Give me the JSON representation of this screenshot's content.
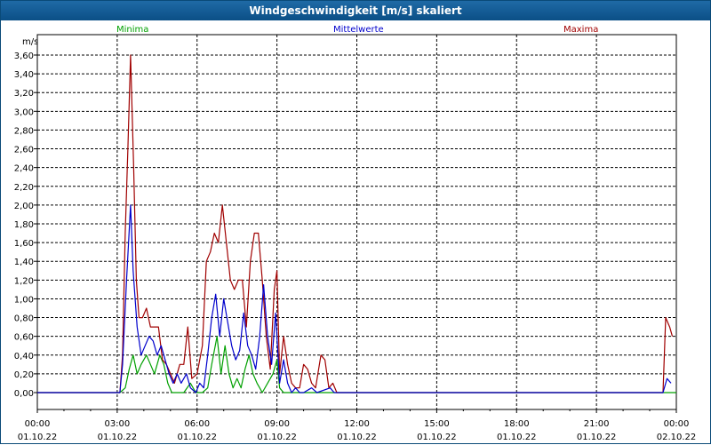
{
  "window": {
    "title": "Windgeschwindigkeit [m/s] skaliert"
  },
  "colors": {
    "min": "#00a000",
    "avg": "#0000cc",
    "max": "#a00000",
    "grid": "#000000",
    "titlebar": "#0b4f86"
  },
  "chart_data": {
    "type": "line",
    "title": "Windgeschwindigkeit [m/s] skaliert",
    "ylabel": "m/s",
    "xlabel": "",
    "ylim": [
      0,
      3.7
    ],
    "y_ticks": [
      "0,00",
      "0,20",
      "0,40",
      "0,60",
      "0,80",
      "1,00",
      "1,20",
      "1,40",
      "1,60",
      "1,80",
      "2,00",
      "2,20",
      "2,40",
      "2,60",
      "2,80",
      "3,00",
      "3,20",
      "3,40",
      "3,60"
    ],
    "x_ticks": [
      {
        "time": "00:00",
        "date": "01.10.22"
      },
      {
        "time": "03:00",
        "date": "01.10.22"
      },
      {
        "time": "06:00",
        "date": "01.10.22"
      },
      {
        "time": "09:00",
        "date": "01.10.22"
      },
      {
        "time": "12:00",
        "date": "01.10.22"
      },
      {
        "time": "15:00",
        "date": "01.10.22"
      },
      {
        "time": "18:00",
        "date": "01.10.22"
      },
      {
        "time": "21:00",
        "date": "01.10.22"
      },
      {
        "time": "00:00",
        "date": "02.10.22"
      }
    ],
    "xlim_hours": [
      0,
      24
    ],
    "grid": true,
    "legend_position": "top",
    "series": [
      {
        "name": "Minima",
        "color": "#00a000",
        "points": [
          [
            0,
            0
          ],
          [
            3.1,
            0
          ],
          [
            3.3,
            0.05
          ],
          [
            3.45,
            0.25
          ],
          [
            3.6,
            0.4
          ],
          [
            3.75,
            0.2
          ],
          [
            3.9,
            0.3
          ],
          [
            4.1,
            0.4
          ],
          [
            4.25,
            0.3
          ],
          [
            4.4,
            0.2
          ],
          [
            4.6,
            0.4
          ],
          [
            4.75,
            0.3
          ],
          [
            4.9,
            0.1
          ],
          [
            5.05,
            0
          ],
          [
            5.5,
            0
          ],
          [
            5.75,
            0.1
          ],
          [
            5.95,
            0
          ],
          [
            6.2,
            0
          ],
          [
            6.4,
            0.05
          ],
          [
            6.55,
            0.3
          ],
          [
            6.75,
            0.6
          ],
          [
            6.9,
            0.2
          ],
          [
            7.05,
            0.5
          ],
          [
            7.2,
            0.2
          ],
          [
            7.35,
            0.05
          ],
          [
            7.5,
            0.15
          ],
          [
            7.65,
            0.05
          ],
          [
            7.8,
            0.25
          ],
          [
            7.95,
            0.4
          ],
          [
            8.1,
            0.2
          ],
          [
            8.25,
            0.1
          ],
          [
            8.35,
            0.05
          ],
          [
            8.45,
            0
          ],
          [
            8.65,
            0.1
          ],
          [
            8.85,
            0.2
          ],
          [
            9.0,
            0.35
          ],
          [
            9.1,
            0.05
          ],
          [
            9.25,
            0
          ],
          [
            24,
            0
          ]
        ]
      },
      {
        "name": "Mittelwerte",
        "color": "#0000cc",
        "points": [
          [
            0,
            0
          ],
          [
            3.1,
            0
          ],
          [
            3.2,
            0.3
          ],
          [
            3.35,
            1.2
          ],
          [
            3.5,
            2.0
          ],
          [
            3.6,
            1.3
          ],
          [
            3.75,
            0.7
          ],
          [
            3.9,
            0.4
          ],
          [
            4.05,
            0.5
          ],
          [
            4.2,
            0.6
          ],
          [
            4.35,
            0.55
          ],
          [
            4.5,
            0.4
          ],
          [
            4.65,
            0.5
          ],
          [
            4.8,
            0.35
          ],
          [
            4.95,
            0.2
          ],
          [
            5.1,
            0.1
          ],
          [
            5.25,
            0.2
          ],
          [
            5.4,
            0.1
          ],
          [
            5.6,
            0.2
          ],
          [
            5.75,
            0.05
          ],
          [
            5.95,
            0
          ],
          [
            6.1,
            0.1
          ],
          [
            6.25,
            0.05
          ],
          [
            6.4,
            0.4
          ],
          [
            6.55,
            0.8
          ],
          [
            6.7,
            1.05
          ],
          [
            6.85,
            0.6
          ],
          [
            7.0,
            1.0
          ],
          [
            7.15,
            0.75
          ],
          [
            7.3,
            0.5
          ],
          [
            7.45,
            0.35
          ],
          [
            7.6,
            0.45
          ],
          [
            7.75,
            0.85
          ],
          [
            7.9,
            0.5
          ],
          [
            8.05,
            0.4
          ],
          [
            8.2,
            0.25
          ],
          [
            8.35,
            0.6
          ],
          [
            8.5,
            1.15
          ],
          [
            8.65,
            0.6
          ],
          [
            8.8,
            0.3
          ],
          [
            8.95,
            0.85
          ],
          [
            9.1,
            0.1
          ],
          [
            9.25,
            0.35
          ],
          [
            9.4,
            0.1
          ],
          [
            9.55,
            0
          ],
          [
            9.7,
            0.05
          ],
          [
            9.85,
            0
          ],
          [
            10.0,
            0
          ],
          [
            10.3,
            0.05
          ],
          [
            10.5,
            0
          ],
          [
            11.0,
            0.05
          ],
          [
            11.15,
            0
          ],
          [
            23.5,
            0
          ],
          [
            23.65,
            0.15
          ],
          [
            23.8,
            0.1
          ]
        ]
      },
      {
        "name": "Maxima",
        "color": "#a00000",
        "points": [
          [
            0,
            0
          ],
          [
            3.1,
            0
          ],
          [
            3.2,
            0.4
          ],
          [
            3.3,
            1.7
          ],
          [
            3.4,
            2.6
          ],
          [
            3.5,
            3.6
          ],
          [
            3.62,
            2.4
          ],
          [
            3.72,
            1.2
          ],
          [
            3.82,
            0.8
          ],
          [
            3.95,
            0.8
          ],
          [
            4.1,
            0.9
          ],
          [
            4.25,
            0.7
          ],
          [
            4.4,
            0.7
          ],
          [
            4.55,
            0.7
          ],
          [
            4.7,
            0.35
          ],
          [
            4.85,
            0.3
          ],
          [
            5.0,
            0.2
          ],
          [
            5.15,
            0.1
          ],
          [
            5.35,
            0.3
          ],
          [
            5.5,
            0.3
          ],
          [
            5.65,
            0.7
          ],
          [
            5.8,
            0.15
          ],
          [
            6.0,
            0.2
          ],
          [
            6.2,
            0.5
          ],
          [
            6.35,
            1.4
          ],
          [
            6.5,
            1.5
          ],
          [
            6.65,
            1.7
          ],
          [
            6.8,
            1.6
          ],
          [
            6.95,
            2.0
          ],
          [
            7.1,
            1.6
          ],
          [
            7.25,
            1.2
          ],
          [
            7.4,
            1.1
          ],
          [
            7.55,
            1.2
          ],
          [
            7.7,
            1.2
          ],
          [
            7.85,
            0.7
          ],
          [
            8.0,
            1.4
          ],
          [
            8.15,
            1.7
          ],
          [
            8.3,
            1.7
          ],
          [
            8.45,
            1.2
          ],
          [
            8.6,
            0.6
          ],
          [
            8.75,
            0.25
          ],
          [
            8.9,
            1.1
          ],
          [
            9.0,
            1.3
          ],
          [
            9.1,
            0.2
          ],
          [
            9.25,
            0.6
          ],
          [
            9.4,
            0.3
          ],
          [
            9.55,
            0.1
          ],
          [
            9.7,
            0.05
          ],
          [
            9.85,
            0.05
          ],
          [
            10.0,
            0.3
          ],
          [
            10.15,
            0.25
          ],
          [
            10.3,
            0.1
          ],
          [
            10.45,
            0.05
          ],
          [
            10.65,
            0.4
          ],
          [
            10.8,
            0.35
          ],
          [
            10.95,
            0.05
          ],
          [
            11.1,
            0.1
          ],
          [
            11.25,
            0
          ],
          [
            23.5,
            0
          ],
          [
            23.6,
            0.8
          ],
          [
            23.75,
            0.7
          ],
          [
            23.85,
            0.6
          ]
        ]
      }
    ]
  }
}
